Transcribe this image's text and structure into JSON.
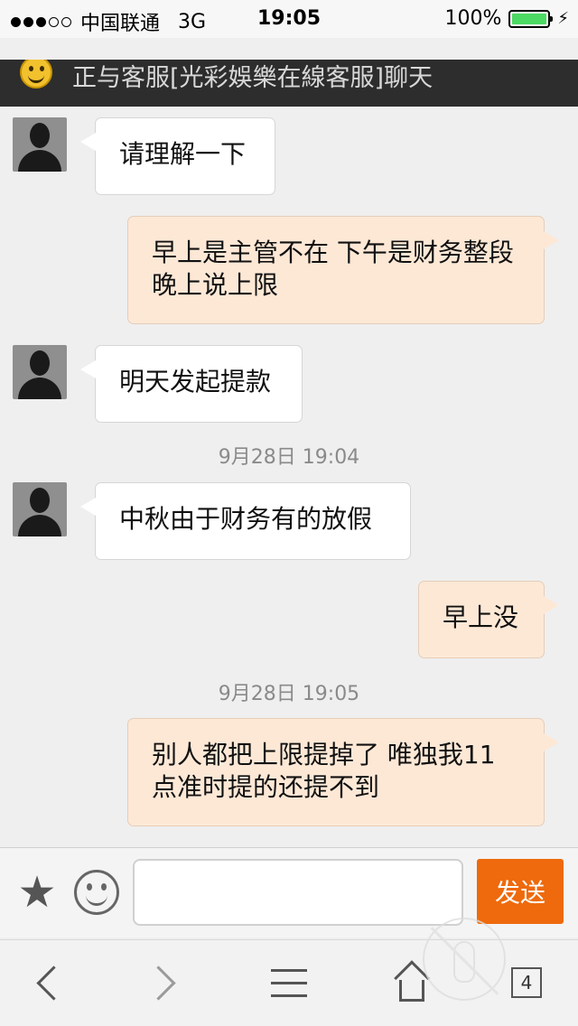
{
  "status_bar": {
    "carrier": "中国联通",
    "network": "3G",
    "time": "19:05",
    "battery": "100%",
    "battery_level": 1.0,
    "battery_color": "#4cd964"
  },
  "header": {
    "title": "正与客服[光彩娛樂在線客服]聊天",
    "icon": "smiley-icon"
  },
  "messages": [
    {
      "side": "in",
      "text": "请理解一下"
    },
    {
      "side": "out",
      "text": "早上是主管不在 下午是财务整段 晚上说上限"
    },
    {
      "side": "in",
      "text": "明天发起提款"
    },
    {
      "side": "time",
      "text": "9月28日 19:04"
    },
    {
      "side": "in",
      "text": "中秋由于财务有的放假"
    },
    {
      "side": "out",
      "text": "早上没"
    },
    {
      "side": "time",
      "text": "9月28日 19:05"
    },
    {
      "side": "out",
      "text": "别人都把上限提掉了 唯独我11点准时提的还提不到"
    }
  ],
  "input_bar": {
    "value": "",
    "placeholder": "",
    "send_label": "发送",
    "send_color": "#ee6a0c"
  },
  "toolbar": {
    "tab_count": "4"
  },
  "colors": {
    "incoming_bubble": "#ffffff",
    "outgoing_bubble": "#fde8d6",
    "header_bg": "#2d2d2d"
  }
}
